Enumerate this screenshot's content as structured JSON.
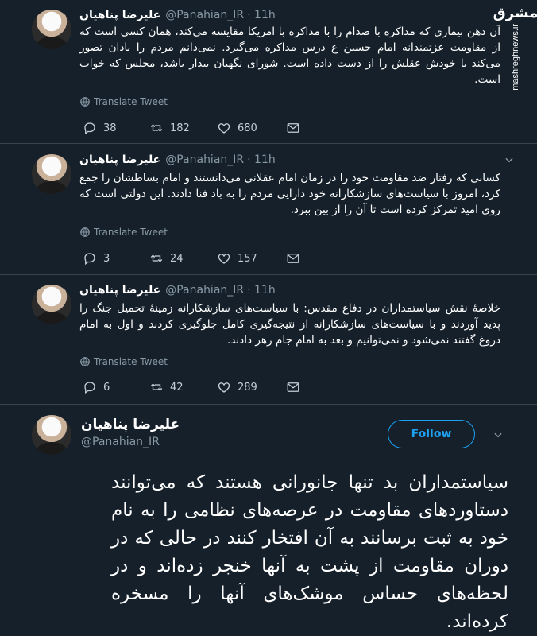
{
  "watermark": {
    "logo": "مشرق",
    "url": "mashreghnews.ir"
  },
  "tweets": [
    {
      "name": "علیرضا پناهیان",
      "handle": "@Panahian_IR",
      "time": "· 11h",
      "text": "آن ذهن بیماری که مذاکره با صدام را با مذاکره با امریکا مقایسه می‌کند، همان کسی است که از مقاومت عزتمندانه امام حسین ع درس مذاکره می‌گیرد. نمی‌دانم مردم را نادان تصور می‌کند یا خودش عقلش را از دست داده است. شورای نگهبان بیدار باشد، مجلس که خواب است.",
      "translate": "Translate Tweet",
      "replies": "38",
      "retweets": "182",
      "likes": "680"
    },
    {
      "name": "علیرضا پناهیان",
      "handle": "@Panahian_IR",
      "time": "· 11h",
      "text": "کسانی که رفتار ضد مقاومت خود را در زمان امام عقلانی می‌دانستند و امام بساطشان را جمع کرد، امروز با سیاست‌های سازشکارانه خود دارایی مردم را به باد فنا دادند. این دولتی است که روی امید تمرکز کرده است تا آن را از بین ببرد.",
      "translate": "Translate Tweet",
      "replies": "3",
      "retweets": "24",
      "likes": "157"
    },
    {
      "name": "علیرضا پناهیان",
      "handle": "@Panahian_IR",
      "time": "· 11h",
      "text": "خلاصهٔ نقش سیاستمداران در دفاع مقدس: با سیاست‌های سازشکارانه زمینهٔ تحمیل جنگ را پدید آوردند و با سیاست‌های سازشکارانه از نتیجه‌گیری کامل جلوگیری کردند و اول به امام دروغ گفتند نمی‌شود و نمی‌توانیم و بعد به امام جام زهر دادند.",
      "translate": "Translate Tweet",
      "replies": "6",
      "retweets": "42",
      "likes": "289"
    }
  ],
  "expanded": {
    "name": "علیرضا پناهیان",
    "handle": "@Panahian_IR",
    "follow_label": "Follow",
    "text": "سیاستمداران بد تنها جانورانی هستند که می‌توانند دستاوردهای مقاومت در عرصه‌های نظامی را به نام خود به ثبت برسانند به آن افتخار کنند در حالی که در دوران مقاومت از پشت به آنها خنجر زده‌اند و در لحظه‌های حساس موشک‌های آنها را مسخره کرده‌اند."
  },
  "colors": {
    "background": "#15202b",
    "accent": "#1da1f2",
    "muted": "#8899a6"
  },
  "icons": [
    "globe-icon",
    "reply-icon",
    "retweet-icon",
    "like-icon",
    "message-icon",
    "chevron-down-icon"
  ]
}
